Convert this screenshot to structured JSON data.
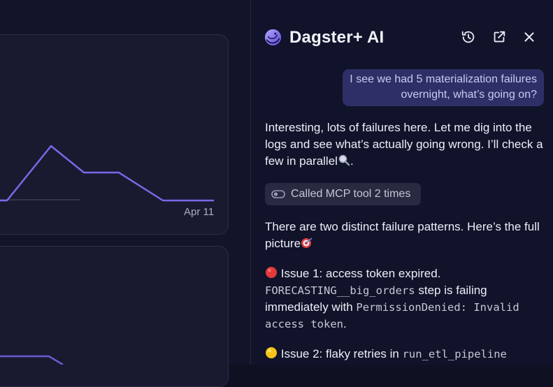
{
  "chart": {
    "tick_label": "Apr 11",
    "line_color": "#7a68e8"
  },
  "panel": {
    "title": "Dagster+ AI",
    "icons": {
      "history": "history-icon",
      "open_external": "external-link-icon",
      "close": "close-icon"
    }
  },
  "chat": {
    "user_message": "I see we had 5 materialization failures overnight, what’s going on?",
    "reply_1": "Interesting, lots of failures here. Let me dig into the logs and see what’s actually going wrong. I’ll check a few in parallel",
    "reply_1_end": ".",
    "tool_call": "Called MCP tool 2 times",
    "reply_2": "There are two distinct failure patterns. Here’s the full picture",
    "issue_1": {
      "title": "Issue 1: access token expired.",
      "step_code": "FORECASTING__big_orders",
      "text_a": " step is failing immediately with ",
      "error_code": "PermissionDenied: Invalid access token",
      "text_b": "."
    },
    "issue_2": {
      "title": "Issue 2: flaky retries in ",
      "pipeline_code": "run_etl_pipeline"
    }
  },
  "colors": {
    "background": "#0f1122",
    "bubble": "#2e2f66",
    "accent": "#7a68e8",
    "red_status": "#e23a3a",
    "yellow_status": "#f5c518"
  }
}
